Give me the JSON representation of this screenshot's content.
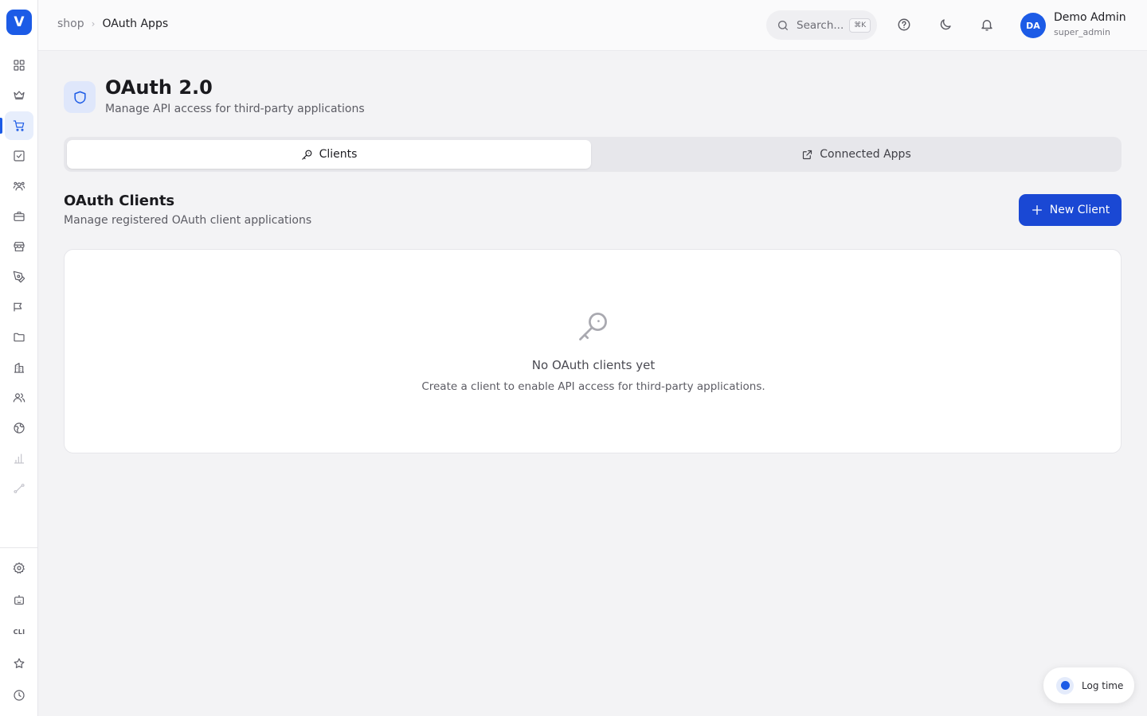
{
  "app": {
    "logo_letter": "V"
  },
  "breadcrumb": {
    "parent": "shop",
    "separator": "›",
    "current": "OAuth Apps"
  },
  "search": {
    "placeholder": "Search...",
    "shortcut": "⌘K"
  },
  "user": {
    "initials": "DA",
    "name": "Demo Admin",
    "role": "super_admin"
  },
  "sidebar": {
    "active_index": 2,
    "items": [
      {
        "icon": "dashboard-icon"
      },
      {
        "icon": "crown-icon"
      },
      {
        "icon": "shopping-cart-icon"
      },
      {
        "icon": "checkbox-icon"
      },
      {
        "icon": "users-group-icon"
      },
      {
        "icon": "briefcase-icon"
      },
      {
        "icon": "store-icon"
      },
      {
        "icon": "pen-tool-icon"
      },
      {
        "icon": "megaphone-icon"
      },
      {
        "icon": "folder-icon"
      },
      {
        "icon": "building-icon"
      },
      {
        "icon": "team-icon"
      },
      {
        "icon": "globe-icon"
      },
      {
        "icon": "bar-chart-icon"
      },
      {
        "icon": "route-icon"
      }
    ],
    "bottom_items": [
      {
        "icon": "settings-icon"
      },
      {
        "icon": "bot-icon"
      },
      {
        "icon": "cli-icon",
        "label": "CLI"
      },
      {
        "icon": "star-icon"
      },
      {
        "icon": "clock-icon"
      }
    ]
  },
  "page": {
    "title": "OAuth 2.0",
    "subtitle": "Manage API access for third-party applications"
  },
  "tabs": [
    {
      "label": "Clients",
      "icon": "key-icon",
      "active": true
    },
    {
      "label": "Connected Apps",
      "icon": "external-link-icon",
      "active": false
    }
  ],
  "section": {
    "title": "OAuth Clients",
    "subtitle": "Manage registered OAuth client applications",
    "new_button": "New Client"
  },
  "empty_state": {
    "icon": "key-icon",
    "title": "No OAuth clients yet",
    "message": "Create a client to enable API access for third-party applications."
  },
  "log_time": {
    "label": "Log time"
  },
  "colors": {
    "accent": "#1c5be6",
    "button": "#1a48d4"
  }
}
